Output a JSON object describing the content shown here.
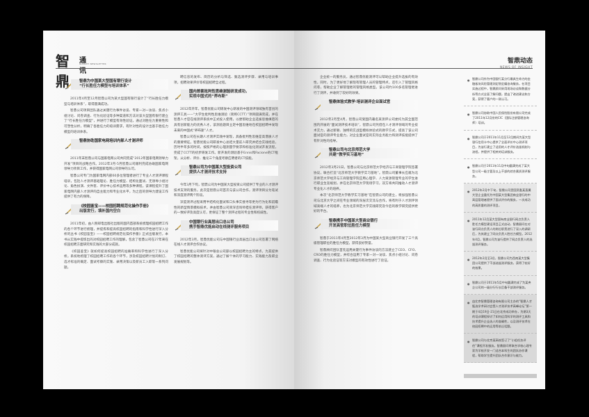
{
  "header": {
    "logo_mark": "智鼎",
    "logo_text": "通讯",
    "logo_sub": "INSIGHT NEWSLETTER",
    "section_title": "智鼎动态",
    "section_subtitle": "NEWS OF INSIGHT"
  },
  "left": {
    "col1": {
      "a1_title": "智鼎为中国某大型国有银行设计",
      "a1_title2": "“行长胜任力模型与培训体系”",
      "a1_paras": [
        "2011年4月至12月智鼎公司为某大型国有银行设计了“行长胜任力模型与培训体系”，取得圆满成功。",
        "智鼎公司项目团队通过关键行为事件访谈、专家一对一访谈、焦点小组讨论、问卷调查、行为化验证等多种渠道和方法对该大型国有银行建立了“行长胜任力模型”，并进行了模型有效性验证。通过对胜任力重要性和可塑性分析，明确了各胜任力的培训需求，有针对性的设计出基于胜任力模型的培训体系。"
      ],
      "a2_title": "智鼎协助国家电网培训内部人才测评师",
      "a2_paras": [
        "2011年末智鼎公司与国家电网公司共同完成“2012年国家电网领导力开发”项目的战略合作。2012年3月-5月智鼎公司顺利完成协助国家电网领导力项目工作，并获得国家电网公司领导的认可。",
        "智鼎公司专门为国家电网内部60多位管理者进行了专业人才测评课程培训，包括人才测评基础理论、胜任力模型、结构化面试、无领导小组讨论、角色扮演、文件筐、评价中心技术运用等多种课程。该课程提升了国家电网内部人才测评的自主能力和专业化水平，为之后的领导力建设工作提供了有力的保障。"
      ],
      "a3_title": "《校园鉴宝——校园招聘规范化操作手册》",
      "a3_title2": "出版发行，填补国内空白",
      "a3_paras": [
        "2011年初，由人民邮电出版社出版的国内首部系统梳理校园招聘工作的各个环节进行梳理，并提炼和提高校园招聘的指南和科学性进行深入分析的丛书《校园鉴宝》——校园招聘规范化操作手册》正式出版发行，本书从实践中提炼出的对校园招聘工作的理解，包含了智鼎公司在27年来在校园招聘方面研究和实践的大部分成就。",
        "《校园鉴宝》就如何提高校园招聘的准确率和科学性进行了深入分析。系统地梳理了校园招聘工作的各个环节，涉及校园招聘计划的制订、选才标准的确定、面试考察的实施、录用决策以及新员工入职等一系列问题。"
      ]
    },
    "col2": {
      "intro_paras": [
        "聘信息的发布、简历的分析与筛选、甄选测评步骤、录用与培训事项，招聘效果评价等校园招聘全过程。"
      ],
      "b1_title": "国内首套批判性思维测验研发成功，",
      "b1_title2": "实现中国式的“养布斯”",
      "b1_paras": [
        "2012年开年，智鼎优能公司研发中心研发的中国测评领域独有首创的测评工具——“大学生批判性思维测验（简称CCTT）”项目圆满完成，并在智鼎人才官在线测评系统中正式投入使用，以便帮助企业选拔思维缜密的具有创新能力的优秀人才。该测验题目立足中国思维地在校园招聘中发现未来的中国式“养布斯”人才。",
        "智鼎公司在长期人才测评实践中发现，具备批判性思维是高潜质人才的重要特征。智鼎优能公司研发中心总结大量前人研究并结合实践经验，历时半年多的时间，按照严格的心理测量学要求和标准化测试开发流程，完成了CCTT的初步研发工作。新开发的测验基于Ennis和Facione的CT框架，从分析、评价、推论三个角度考察应聘者的CT技能。"
      ],
      "b2_title": "智鼎公司为中国某大型投资公司",
      "b2_title2": "提供人才测评技术支持",
      "b2_paras": [
        "今年3月下旬，智鼎公司为中国某大型投资公司提供了专业的人才测评技术支持的服务。此次是智鼎公司首次与该公司合作，测评项目分为笔试和深度测评两个阶段。",
        "深度测评过程采用半结构化面试和口头事实搜寻等更为行为化和前瞻性的新型情景模拟技术，并由智鼎公司资深咨询师担任测评师，获得客户的一致好评及高度认可，更保证了整个测评过程的专业性和权威性。"
      ],
      "b3_title": "中国银行业高层出口总公司",
      "b3_title2": "携手智鼎优能启动在线测评服务项目",
      "b3_paras": [
        "2012年3月，智鼎优能公司与中国银行业高层出口总公司签署了网络在线人才测评合作协议。",
        "智鼎优能公司将针对中银总公司部以校园招聘为主的特点，为其提供了校园招聘的整体测评方案，通过了解个体的学习能力、实践能力及职业发展规划等。"
      ]
    }
  },
  "right": {
    "col3": {
      "intro_paras": [
        "企业统一的服务员，通过智鼎优能测评可以帮助企业提升选拔的有效性，同时，为了更好地了解现有管理人员的管理特点，还引入了管理风格问卷，帮助企业了解管理者的管理风格类型。该公司约100多名管理者进行了测评，并收到了较好的效果。"
      ],
      "c1_title": "智鼎体验式教学·培训测评企业面试官",
      "c1_paras": [
        "2012年2月至4月，智鼎公司受国内著名某测评公司委托为其全国范围内开展的“面试测评技术培训”，智鼎公司凭借在人才测评领域的专业技术实力，通过新颖、独特的实战型模拟体验式的教学方式，提高了该公司面试官的测评专业能力，对企业面试官的实际业务能力和测评技能提供了有针对性的指导。"
      ],
      "c2_title": "智鼎公司与北京师范大学",
      "c2_title2": "共建“教学实习基地”",
      "c2_paras": [
        "2012年3月21日，智鼎公司与北京师范大学经济与工商管理学院签署协议，联合打造“北京师范大学教学实习基地”。智鼎公司董事长应邀为北京师范大学经济与工商管理学院应用心理学、人力资源管理专业的学生进行职业生涯规划，并在北京师范大学现场学习，双方将共同推动人才测评专业化人才的培养。",
        "本次“北京师范大学教学实习基地”在智鼎公司的建立，将加强智鼎公司与北京大学之间在专业领域的深层次交流与合作，将有利于人才测评领域高端人才的培养，也为北京师范大学实践研究及今后的教学研究提供更好的平台。"
      ],
      "c3_title": "智鼎携手中国某大型商业银行",
      "c3_title2": "开发高管职位胜任力模型",
      "c3_paras": [
        "智鼎于2011年4月至2012年3月为中国某大型商业银行开发了三个高级管理职位的胜任力模型，获得良好赞誉。",
        "智鼎顾问团队首先运用关键行为事件访谈的方法建立了CEO、CFO、CRO的胜任力模型，并综合运用了专家一对一访谈、焦点小组讨论、问卷调查、行为化验证等方法对模型的有效性进行了验证。"
      ]
    },
    "sidebar": {
      "items": [
        "智鼎公司作为中国银行某分行最具生命力的金融板块风险管理测定院定编咨询服务，在项目实施过程中，智鼎顾问采用现场访谈和数据分析等方式全面了解问题，提出了改进建议和方案，获得了客户的一致认可。",
        "智鼎公司协助中国人民保险股份有限公司完成了2011年12月份的CIC（国际注册管理咨询师）培训。",
        "智鼎公司于2011年11月至12月期间为某大型银行信用卡中心提供了全面评价中心测评项目，为该行建立了适用的人才评价选拔机制与流程，并提供了相关的培训服务。",
        "智鼎公司于2011年11月中旬圆满完成了某大型公司一级主管及以上干部的综合素质测评服务。",
        "2012年2月中下旬，智鼎公司受国资委某直属大型企业委托为中国某大型集团商业银行的中高层管理者提供了面试评价的服务，一次成功的高质量的测评项目。",
        "2011年12月某大型国有商业银行网点负责人胜任力模型建设项目正式启动，智鼎顾问在对该行网点负责人的岗位职责进行了深入的调研后，为其建立了网点负责人胜任力模型。2012年4月，智鼎公司为该行提供了网点负责人的选拔测评服务。",
        "2012年2月至3月，智鼎公司为西南某大型集团公司提供了干部选拔测评服务，获得了较好的效果。",
        "智鼎公司于2011年5月中旬圆满完成了为某央企公司的一级分行行长后备干部测评服务。",
        "由北京智鼎管理咨询有限公司主办的“智鼎人才甄选学术研讨会暨人才测评技术高峰论坛”第一期于4月19日-21日在北京成功举办，为期3天的培训课程探讨了如何运用科学的测评工具和技术提升企业选人的准确性，以及测评技术在校园招聘中的运用等前沿话题。",
        "智鼎公司与北京某高校签订了“小组任务评估”课程开发服务。智鼎顾问将联合学校心理专家为学校开发一门适合本科生的团队协作课程，帮助学生提升团队合作意识与能力。"
      ]
    }
  }
}
